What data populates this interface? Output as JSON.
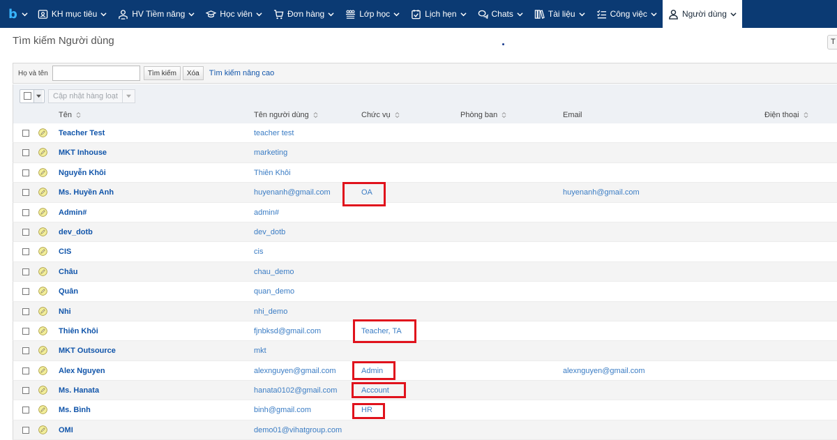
{
  "nav": {
    "logo": "b",
    "items": [
      {
        "label": "KH mục tiêu",
        "icon": "target-icon"
      },
      {
        "label": "HV Tiềm năng",
        "icon": "user-star-icon"
      },
      {
        "label": "Học viên",
        "icon": "graduation-cap-icon"
      },
      {
        "label": "Đơn hàng",
        "icon": "cart-icon"
      },
      {
        "label": "Lớp học",
        "icon": "class-group-icon"
      },
      {
        "label": "Lịch hẹn",
        "icon": "calendar-check-icon"
      },
      {
        "label": "Chats",
        "icon": "chat-icon"
      },
      {
        "label": "Tài liệu",
        "icon": "books-icon"
      },
      {
        "label": "Công việc",
        "icon": "task-list-icon"
      },
      {
        "label": "Người dùng",
        "icon": "user-icon"
      }
    ],
    "colors": {
      "bar": "#0b3a73",
      "logo": "#39b6ff",
      "active_bg": "#ffffff"
    }
  },
  "page": {
    "title": "Tìm kiếm Người dùng",
    "edge_button": "T"
  },
  "search": {
    "label": "Họ và tên",
    "value": "",
    "placeholder": "",
    "search_button": "Tìm kiếm",
    "clear_button": "Xóa",
    "advanced_link": "Tìm kiếm nâng cao"
  },
  "toolbar": {
    "mass_update": "Cập nhật hàng loạt"
  },
  "columns": {
    "name": "Tên",
    "username": "Tên người dùng",
    "role": "Chức vụ",
    "department": "Phòng ban",
    "email": "Email",
    "phone": "Điện thoại"
  },
  "rows": [
    {
      "name": "Teacher Test",
      "username": "teacher test",
      "role": "",
      "email": ""
    },
    {
      "name": "MKT Inhouse",
      "username": "marketing",
      "role": "",
      "email": ""
    },
    {
      "name": "Nguyễn Khôi",
      "username": "Thiên Khôi",
      "role": "",
      "email": ""
    },
    {
      "name": "Ms. Huyền Anh",
      "username": "huyenanh@gmail.com",
      "role": "OA",
      "email": "huyenanh@gmail.com"
    },
    {
      "name": "Admin#",
      "username": "admin#",
      "role": "",
      "email": ""
    },
    {
      "name": "dev_dotb",
      "username": "dev_dotb",
      "role": "",
      "email": ""
    },
    {
      "name": "CIS",
      "username": "cis",
      "role": "",
      "email": ""
    },
    {
      "name": "Châu",
      "username": "chau_demo",
      "role": "",
      "email": ""
    },
    {
      "name": "Quân",
      "username": "quan_demo",
      "role": "",
      "email": ""
    },
    {
      "name": "Nhi",
      "username": "nhi_demo",
      "role": "",
      "email": ""
    },
    {
      "name": "Thiên Khôi",
      "username": "fjnbksd@gmail.com",
      "role": "Teacher, TA",
      "email": ""
    },
    {
      "name": "MKT Outsource",
      "username": "mkt",
      "role": "",
      "email": ""
    },
    {
      "name": "Alex Nguyen",
      "username": "alexnguyen@gmail.com",
      "role": "Admin",
      "email": "alexnguyen@gmail.com"
    },
    {
      "name": "Ms. Hanata",
      "username": "hanata0102@gmail.com",
      "role": "Account",
      "email": ""
    },
    {
      "name": "Ms. Bình",
      "username": "binh@gmail.com",
      "role": "HR",
      "email": ""
    },
    {
      "name": "OMI",
      "username": "demo01@vihatgroup.com",
      "role": "",
      "email": ""
    }
  ],
  "annotation_color": "#e0121c"
}
